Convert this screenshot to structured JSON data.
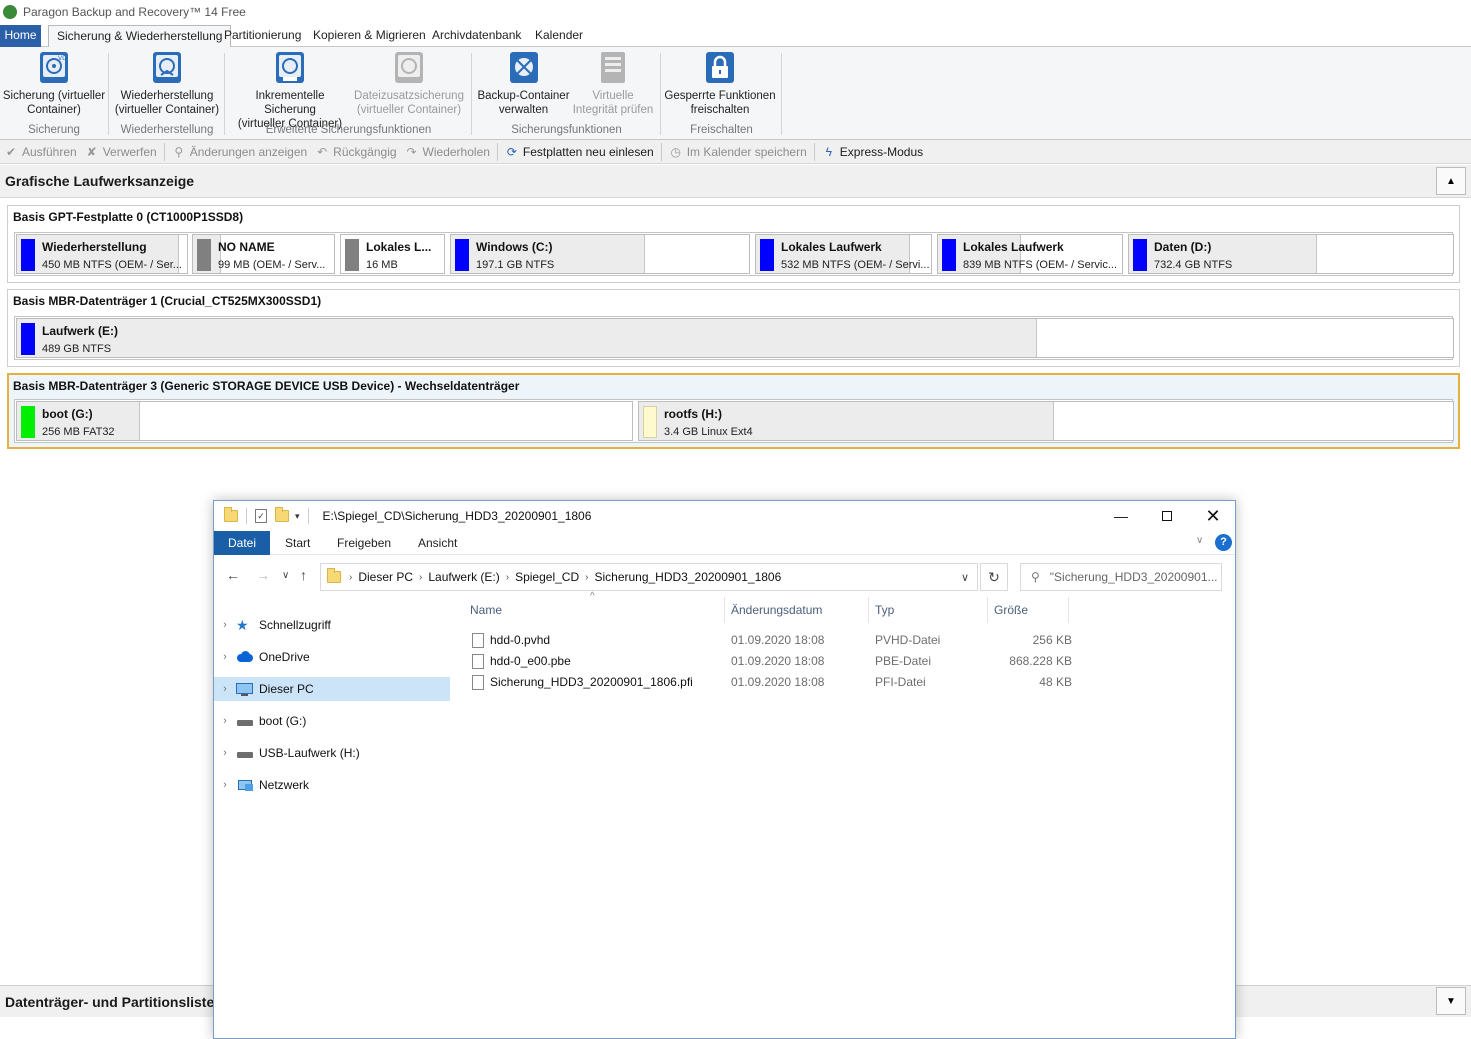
{
  "app": {
    "title": "Paragon Backup and Recovery™ 14 Free"
  },
  "tabs": [
    "Home",
    "Sicherung & Wiederherstellung",
    "Partitionierung",
    "Kopieren & Migrieren",
    "Archivdatenbank",
    "Kalender"
  ],
  "ribbon": {
    "buttons": [
      {
        "l1": "Sicherung (virtueller",
        "l2": "Container)"
      },
      {
        "l1": "Wiederherstellung",
        "l2": "(virtueller Container)"
      },
      {
        "l1": "Inkrementelle Sicherung",
        "l2": "(virtueller Container)"
      },
      {
        "l1": "Dateizusatzsicherung",
        "l2": "(virtueller Container)"
      },
      {
        "l1": "Backup-Container",
        "l2": "verwalten"
      },
      {
        "l1": "Virtuelle",
        "l2": "Integrität prüfen"
      },
      {
        "l1": "Gesperrte Funktionen",
        "l2": "freischalten"
      }
    ],
    "groups": [
      "Sicherung",
      "Wiederherstellung",
      "Erweiterte Sicherungsfunktionen",
      "Sicherungsfunktionen",
      "Freischalten"
    ]
  },
  "toolbar": [
    "Ausführen",
    "Verwerfen",
    "Änderungen anzeigen",
    "Rückgängig",
    "Wiederholen",
    "Festplatten neu einlesen",
    "Im Kalender speichern",
    "Express-Modus"
  ],
  "graphic_view": {
    "title": "Grafische Laufwerksanzeige"
  },
  "disks": [
    {
      "title": "Basis GPT-Festplatte 0 (CT1000P1SSD8)",
      "partitions": [
        {
          "name": "Wiederherstellung",
          "info": "450 MB NTFS (OEM- / Ser...",
          "color": "#0000ff",
          "used": 0.95
        },
        {
          "name": "NO NAME",
          "info": "99 MB  (OEM- / Serv...",
          "color": "#808080",
          "used": 0.2
        },
        {
          "name": "Lokales L...",
          "info": "16 MB",
          "color": "#808080",
          "used": 0.0
        },
        {
          "name": "Windows (C:)",
          "info": "197.1 GB NTFS",
          "color": "#0000ff",
          "used": 0.65
        },
        {
          "name": "Lokales Laufwerk",
          "info": "532 MB NTFS (OEM- / Servi...",
          "color": "#0000ff",
          "used": 0.88
        },
        {
          "name": "Lokales Laufwerk",
          "info": "839 MB NTFS (OEM- / Servic...",
          "color": "#0000ff",
          "used": 0.45
        },
        {
          "name": "Daten (D:)",
          "info": "732.4 GB NTFS",
          "color": "#0000ff",
          "used": 0.58
        }
      ]
    },
    {
      "title": "Basis MBR-Datenträger 1 (Crucial_CT525MX300SSD1)",
      "partitions": [
        {
          "name": "Laufwerk (E:)",
          "info": "489 GB NTFS",
          "color": "#0000ff",
          "used": 0.71
        }
      ]
    },
    {
      "title": "Basis MBR-Datenträger 3 (Generic STORAGE DEVICE USB Device) - Wechseldatenträger",
      "partitions": [
        {
          "name": "boot (G:)",
          "info": "256 MB FAT32",
          "color": "#00ee00",
          "used": 0.2
        },
        {
          "name": "rootfs (H:)",
          "info": "3.4 GB Linux Ext4",
          "color": "#fffacd",
          "used": 0.51
        }
      ]
    }
  ],
  "partition_list": {
    "title": "Datenträger- und Partitionsliste"
  },
  "explorer": {
    "title_path": "E:\\Spiegel_CD\\Sicherung_HDD3_20200901_1806",
    "ribbon_tabs": [
      "Datei",
      "Start",
      "Freigeben",
      "Ansicht"
    ],
    "breadcrumb": [
      "Dieser PC",
      "Laufwerk (E:)",
      "Spiegel_CD",
      "Sicherung_HDD3_20200901_1806"
    ],
    "search_placeholder": "\"Sicherung_HDD3_20200901...",
    "nav": [
      "Schnellzugriff",
      "OneDrive",
      "Dieser PC",
      "boot (G:)",
      "USB-Laufwerk (H:)",
      "Netzwerk"
    ],
    "columns": [
      "Name",
      "Änderungsdatum",
      "Typ",
      "Größe"
    ],
    "files": [
      {
        "name": "hdd-0.pvhd",
        "date": "01.09.2020 18:08",
        "type": "PVHD-Datei",
        "size": "256 KB"
      },
      {
        "name": "hdd-0_e00.pbe",
        "date": "01.09.2020 18:08",
        "type": "PBE-Datei",
        "size": "868.228 KB"
      },
      {
        "name": "Sicherung_HDD3_20200901_1806.pfi",
        "date": "01.09.2020 18:08",
        "type": "PFI-Datei",
        "size": "48 KB"
      }
    ]
  }
}
